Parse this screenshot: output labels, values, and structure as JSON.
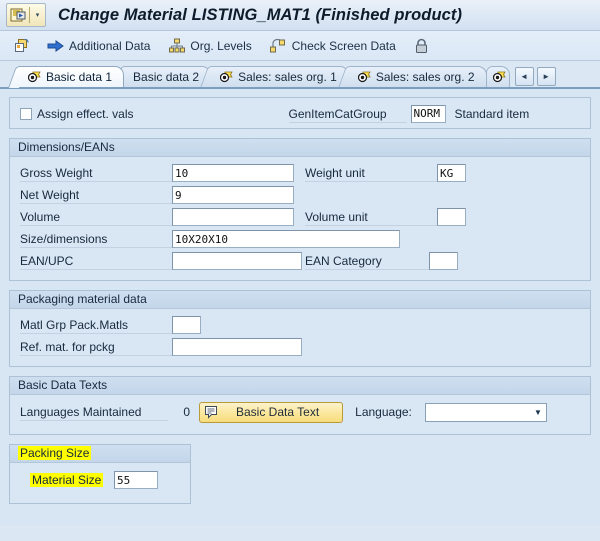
{
  "window": {
    "title": "Change Material LISTING_MAT1 (Finished product)",
    "system_menu_icon": "sap-menu-icon",
    "system_menu_caret": "▾"
  },
  "toolbar": {
    "items": [
      {
        "icon": "copy-icon",
        "label": ""
      },
      {
        "icon": "arrow-right-icon",
        "label": "Additional Data"
      },
      {
        "icon": "org-levels-icon",
        "label": "Org. Levels"
      },
      {
        "icon": "check-screen-icon",
        "label": "Check Screen Data"
      },
      {
        "icon": "lock-icon",
        "label": ""
      }
    ]
  },
  "tabs": {
    "items": [
      {
        "label": "Basic data 1",
        "icon": "pencil-tab-icon",
        "active": true
      },
      {
        "label": "Basic data 2",
        "icon": "",
        "active": false
      },
      {
        "label": "Sales: sales org. 1",
        "icon": "pencil-tab-icon",
        "active": false
      },
      {
        "label": "Sales: sales org. 2",
        "icon": "pencil-tab-icon",
        "active": false
      },
      {
        "label": "",
        "icon": "pencil-tab-icon",
        "active": false
      }
    ],
    "scroll_left": "◄",
    "scroll_right": "►"
  },
  "top_row": {
    "assign_effect_vals_label": "Assign effect. vals",
    "assign_effect_vals_checked": false,
    "gen_item_cat_group_label": "GenItemCatGroup",
    "gen_item_cat_group_value": "NORM",
    "gen_item_cat_group_text": "Standard item"
  },
  "dimensions": {
    "title": "Dimensions/EANs",
    "gross_weight_label": "Gross Weight",
    "gross_weight_value": "10",
    "weight_unit_label": "Weight unit",
    "weight_unit_value": "KG",
    "net_weight_label": "Net Weight",
    "net_weight_value": "9",
    "volume_label": "Volume",
    "volume_value": "",
    "volume_unit_label": "Volume unit",
    "volume_unit_value": "",
    "size_dimensions_label": "Size/dimensions",
    "size_dimensions_value": "10X20X10",
    "ean_upc_label": "EAN/UPC",
    "ean_upc_value": "",
    "ean_category_label": "EAN Category",
    "ean_category_value": ""
  },
  "packaging": {
    "title": "Packaging material data",
    "matl_grp_label": "Matl Grp Pack.Matls",
    "matl_grp_value": "",
    "ref_mat_label": "Ref. mat. for pckg",
    "ref_mat_value": ""
  },
  "basic_data_texts": {
    "title": "Basic Data Texts",
    "languages_maintained_label": "Languages Maintained",
    "languages_maintained_value": "0",
    "button_label": "Basic Data Text",
    "button_icon": "note-icon",
    "language_label": "Language:",
    "language_value": ""
  },
  "packing_size": {
    "title": "Packing Size",
    "material_size_label": "Material Size",
    "material_size_value": "55",
    "highlight_color": "#ffff00"
  }
}
